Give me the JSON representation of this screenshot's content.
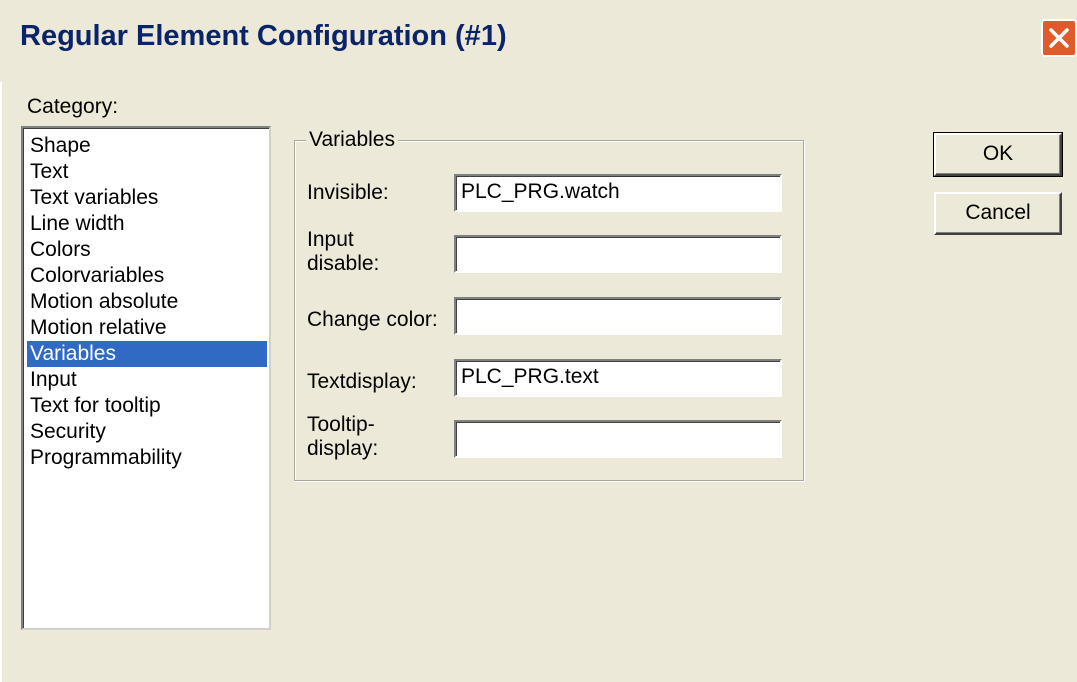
{
  "window": {
    "title": "Regular Element Configuration (#1)"
  },
  "category": {
    "label": "Category:",
    "items": [
      "Shape",
      "Text",
      "Text variables",
      "Line width",
      "Colors",
      "Colorvariables",
      "Motion absolute",
      "Motion relative",
      "Variables",
      "Input",
      "Text for tooltip",
      "Security",
      "Programmability"
    ],
    "selected": "Variables"
  },
  "variables": {
    "group_title": "Variables",
    "invisible_label": "Invisible:",
    "invisible_value": "PLC_PRG.watch",
    "input_disable_label_1": "Input",
    "input_disable_label_2": "disable:",
    "input_disable_value": "",
    "change_color_label": "Change color:",
    "change_color_value": "",
    "textdisplay_label": "Textdisplay:",
    "textdisplay_value": "PLC_PRG.text",
    "tooltip_label_1": "Tooltip-",
    "tooltip_label_2": "display:",
    "tooltip_value": ""
  },
  "buttons": {
    "ok": "OK",
    "cancel": "Cancel"
  },
  "colors": {
    "title_text": "#0a246a",
    "selection": "#316ac5",
    "close_button": "#e05a2b",
    "face": "#ece9d8"
  },
  "icons": {
    "close": "close-icon"
  }
}
